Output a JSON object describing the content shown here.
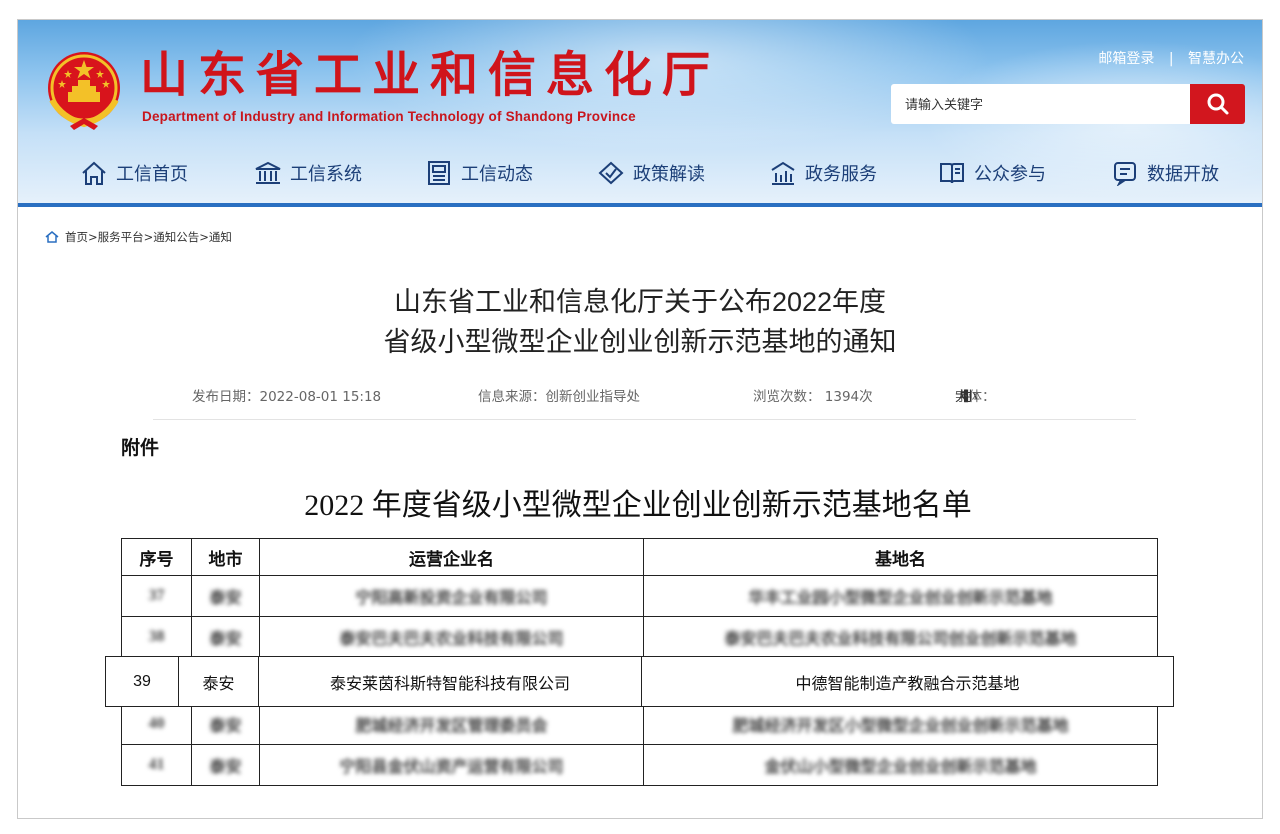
{
  "header": {
    "title": "山东省工业和信息化厅",
    "subtitle": "Department of Industry and Information Technology of Shandong Province",
    "top_links": [
      "邮箱登录",
      "|",
      "智慧办公"
    ],
    "search_placeholder": "请输入关键字"
  },
  "nav": [
    {
      "label": "工信首页",
      "icon": "home-icon"
    },
    {
      "label": "工信系统",
      "icon": "government-building-icon"
    },
    {
      "label": "工信动态",
      "icon": "news-icon"
    },
    {
      "label": "政策解读",
      "icon": "policy-icon"
    },
    {
      "label": "政务服务",
      "icon": "service-icon"
    },
    {
      "label": "公众参与",
      "icon": "participation-icon"
    },
    {
      "label": "数据开放",
      "icon": "data-icon"
    }
  ],
  "breadcrumb": "首页>服务平台>通知公告>通知",
  "article": {
    "title_line1": "山东省工业和信息化厅关于公布2022年度",
    "title_line2": "省级小型微型企业创业创新示范基地的通知",
    "publish_date": "发布日期：2022-08-01 15:18",
    "source": "信息来源：创新创业指导处",
    "views": "浏览次数： 1394次",
    "font_label": "字体：",
    "font_sizes": [
      "【",
      "大",
      "中",
      "小",
      "】"
    ]
  },
  "attachment_label": "附件",
  "list_title": "2022 年度省级小型微型企业创业创新示范基地名单",
  "table": {
    "headers": [
      "序号",
      "地市",
      "运营企业名",
      "基地名"
    ],
    "blurred_rows_before": [
      [
        "37",
        "泰安",
        "宁阳高新投资企业有限公司",
        "华丰工业园小型微型企业创业创新示范基地"
      ],
      [
        "38",
        "泰安",
        "泰安巴夫巴夫农业科技有限公司",
        "泰安巴夫巴夫农业科技有限公司创业创新示范基地"
      ]
    ],
    "highlight_row": [
      "39",
      "泰安",
      "泰安莱茵科斯特智能科技有限公司",
      "中德智能制造产教融合示范基地"
    ],
    "blurred_rows_after": [
      [
        "40",
        "泰安",
        "肥城经济开发区管理委员会",
        "肥城经济开发区小型微型企业创业创新示范基地"
      ],
      [
        "41",
        "泰安",
        "宁阳县金伏山资产运营有限公司",
        "金伏山小型微型企业创业创新示范基地"
      ]
    ]
  },
  "colors": {
    "brand_red": "#d0141b",
    "nav_text": "#1c3f78",
    "header_rule": "#2a6fc1"
  }
}
